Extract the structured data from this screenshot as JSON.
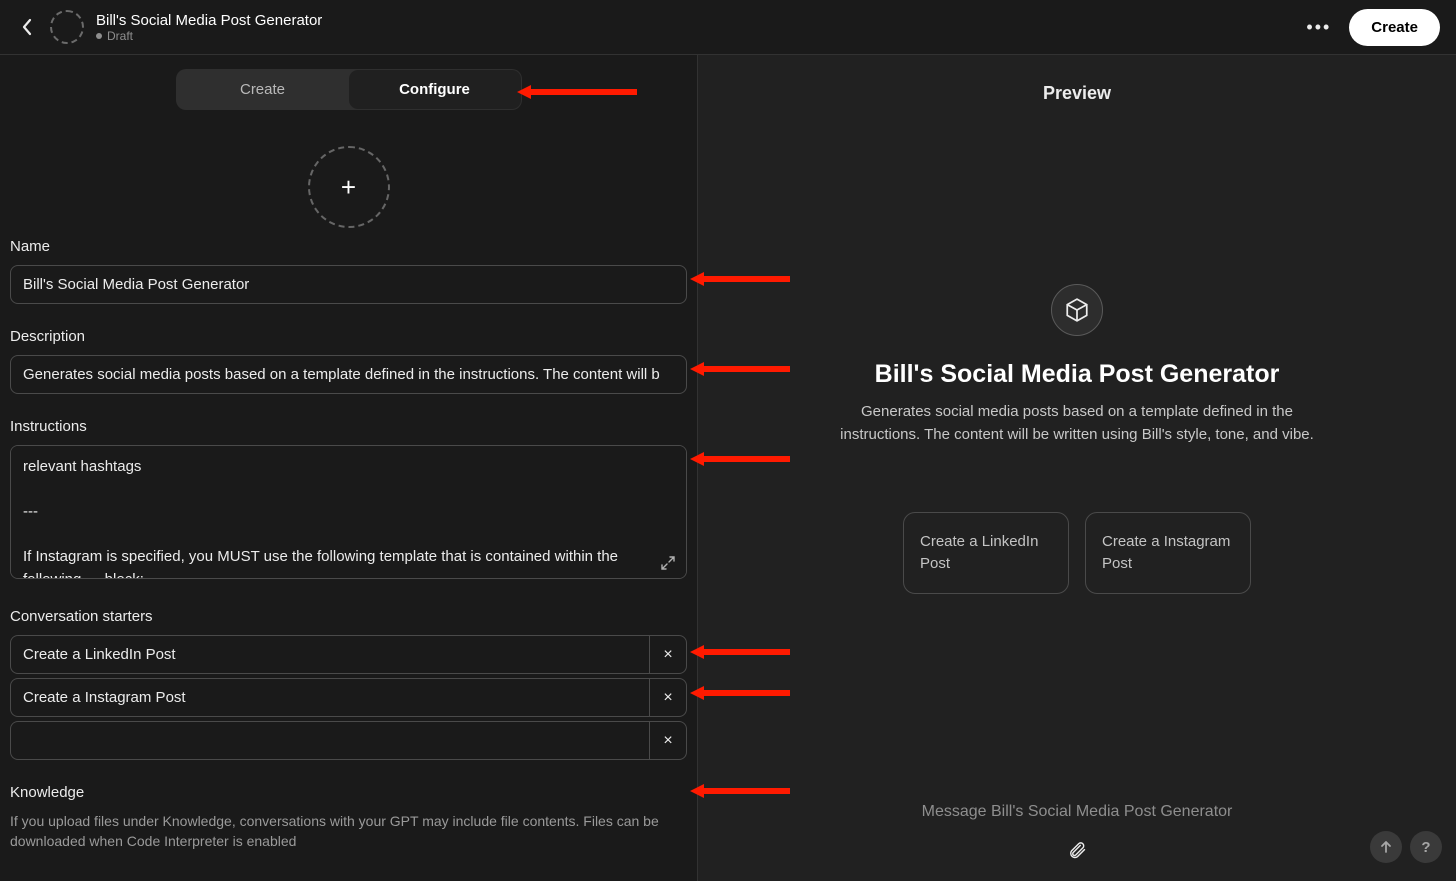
{
  "header": {
    "title": "Bill's Social Media Post Generator",
    "status": "Draft",
    "create_button": "Create"
  },
  "icons": {
    "back": "chevron-left",
    "more": "ellipsis",
    "plus": "+",
    "close": "×",
    "expand": "expand-diagonal",
    "cube": "cube",
    "attach": "paperclip",
    "send": "arrow-up",
    "help": "?"
  },
  "tabs": {
    "create": "Create",
    "configure": "Configure",
    "active": "Configure"
  },
  "form": {
    "name": {
      "label": "Name",
      "value": "Bill's Social Media Post Generator"
    },
    "description": {
      "label": "Description",
      "value": "Generates social media posts based on a template defined in the instructions. The content will b"
    },
    "instructions": {
      "label": "Instructions",
      "value": "relevant hashtags\n\n---\n\nIf Instagram is specified, you MUST use the following template that is contained within the following --- block:"
    },
    "starters": {
      "label": "Conversation starters",
      "items": [
        "Create a LinkedIn Post",
        "Create a Instagram Post",
        ""
      ]
    },
    "knowledge": {
      "label": "Knowledge",
      "description": "If you upload files under Knowledge, conversations with your GPT may include file contents. Files can be downloaded when Code Interpreter is enabled"
    }
  },
  "preview": {
    "header": "Preview",
    "title": "Bill's Social Media Post Generator",
    "description": "Generates social media posts based on a template defined in the instructions. The content will be written using Bill's style, tone, and vibe.",
    "prompt_cards": [
      "Create a LinkedIn Post",
      "Create a Instagram Post"
    ],
    "message_placeholder": "Message Bill's Social Media Post Generator"
  },
  "annotation_color": "#ff1a00"
}
